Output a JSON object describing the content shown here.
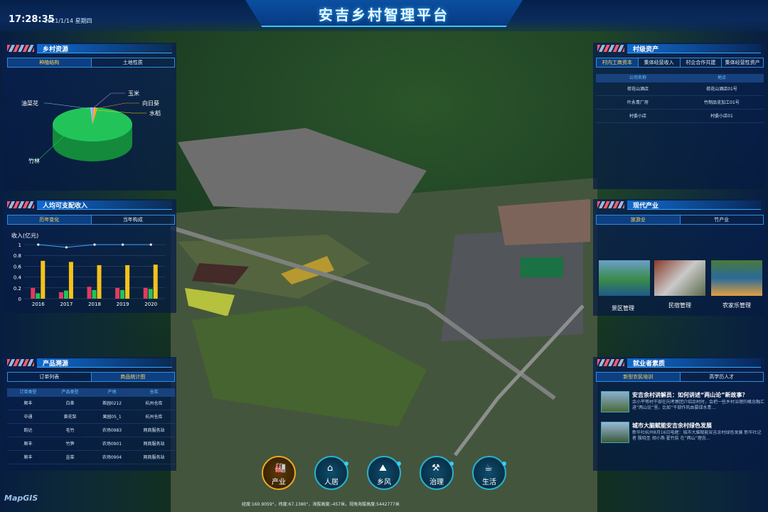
{
  "app": {
    "title": "安吉乡村智理平台",
    "time": "17:28:35",
    "date": "2021/1/14  星期四",
    "logo": "MapGIS",
    "status": "经度:160.9059°，纬度:67.1380°，海拔高度:-457米，视角海拔高度:5442777米"
  },
  "resources": {
    "title": "乡村资源",
    "tabs": [
      "种植结构",
      "土地性质"
    ],
    "active": 0,
    "pie": {
      "type": "pie",
      "labels": [
        "竹林",
        "油菜花",
        "玉米",
        "向日葵",
        "水稻"
      ],
      "values": [
        97,
        1,
        0.6,
        0.6,
        0.8
      ],
      "colors": [
        "#22c45a",
        "#8fc3ff",
        "#c07cff",
        "#ff8a3c",
        "#ffd400"
      ]
    }
  },
  "income": {
    "title": "人均可支配收入",
    "tabs": [
      "历年变化",
      "当年构成"
    ],
    "active": 0,
    "chart_data": {
      "type": "bar",
      "ylabel": "收入(亿元)",
      "categories": [
        "2016",
        "2017",
        "2018",
        "2019",
        "2020"
      ],
      "ylim": [
        0,
        1
      ],
      "yticks": [
        "0",
        "0.2",
        "0.4",
        "0.6",
        "0.8",
        "1"
      ],
      "series": [
        {
          "values": [
            0.2,
            0.12,
            0.22,
            0.2,
            0.2
          ],
          "color": "#e23a5f"
        },
        {
          "values": [
            0.1,
            0.15,
            0.16,
            0.16,
            0.18
          ],
          "color": "#22c45a"
        },
        {
          "values": [
            0.7,
            0.68,
            0.62,
            0.62,
            0.63
          ],
          "color": "#f5c21b"
        }
      ],
      "line": [
        1,
        0.95,
        1,
        1,
        1
      ],
      "line_color": "#3aa7ff"
    }
  },
  "products": {
    "title": "产品溯源",
    "tabs": [
      "订单列表",
      "商品统计图"
    ],
    "active": 1,
    "headers": [
      "订单类型",
      "产品类型",
      "产地",
      "仓库"
    ],
    "rows": [
      [
        "顺丰",
        "白茶",
        "茶园0212",
        "杭州仓库"
      ],
      [
        "中通",
        "黄花梨",
        "果园05_1",
        "杭州仓库"
      ],
      [
        "韵达",
        "毛竹",
        "农场0983",
        "网商服务站"
      ],
      [
        "顺丰",
        "竹笋",
        "农场0901",
        "网商服务站"
      ],
      [
        "顺丰",
        "韭菜",
        "农场0904",
        "网商服务站"
      ]
    ]
  },
  "assets": {
    "title": "村级资产",
    "tabs": [
      "村内工商资本",
      "集体经营收入",
      "村企合作共建",
      "集体经营性资产"
    ],
    "active": 0,
    "headers": [
      "公司名称",
      "地点"
    ],
    "rows": [
      [
        "荷花山酒店",
        "荷花山酒店01号"
      ],
      [
        "叶永青厂房",
        "竹制品览加工01号"
      ],
      [
        "村委小店",
        "村委小店01"
      ]
    ]
  },
  "industry": {
    "title": "现代产业",
    "tabs": [
      "旅游业",
      "竹产业"
    ],
    "active": 0,
    "items": [
      {
        "label": "景区管理",
        "colors": [
          "#3a8a4a",
          "#1e5a8a"
        ]
      },
      {
        "label": "民宿管理",
        "colors": [
          "#8a3a2a",
          "#c9c9c9"
        ]
      },
      {
        "label": "农家乐管理",
        "colors": [
          "#2a6a9a",
          "#e0a040"
        ]
      }
    ]
  },
  "employment": {
    "title": "就业者素质",
    "tabs": [
      "新型农民培训",
      "高学历人才"
    ],
    "active": 0,
    "news": [
      {
        "title": "安吉余村讲解员：如何讲述“两山论”新故事？",
        "excerpt": "余小平等村干部在向考察团介绍余村时，会把一些乡村治理的概念融汇进“两山论”里。比如“干部作风由要绿水青…"
      },
      {
        "title": "城市大脑赋能安吉余村绿色发展",
        "excerpt": "新华社杭州8月16日电题：城市大脑赋能安吉余村绿色发展 新华社记者 殷晓圣 胡小燕 翟竹荻 在“两山”理念…"
      }
    ]
  },
  "dock": [
    {
      "label": "产业",
      "icon": "factory-icon"
    },
    {
      "label": "人居",
      "icon": "house-icon"
    },
    {
      "label": "乡风",
      "icon": "landscape-icon"
    },
    {
      "label": "治理",
      "icon": "tools-icon"
    },
    {
      "label": "生活",
      "icon": "cup-icon"
    }
  ]
}
